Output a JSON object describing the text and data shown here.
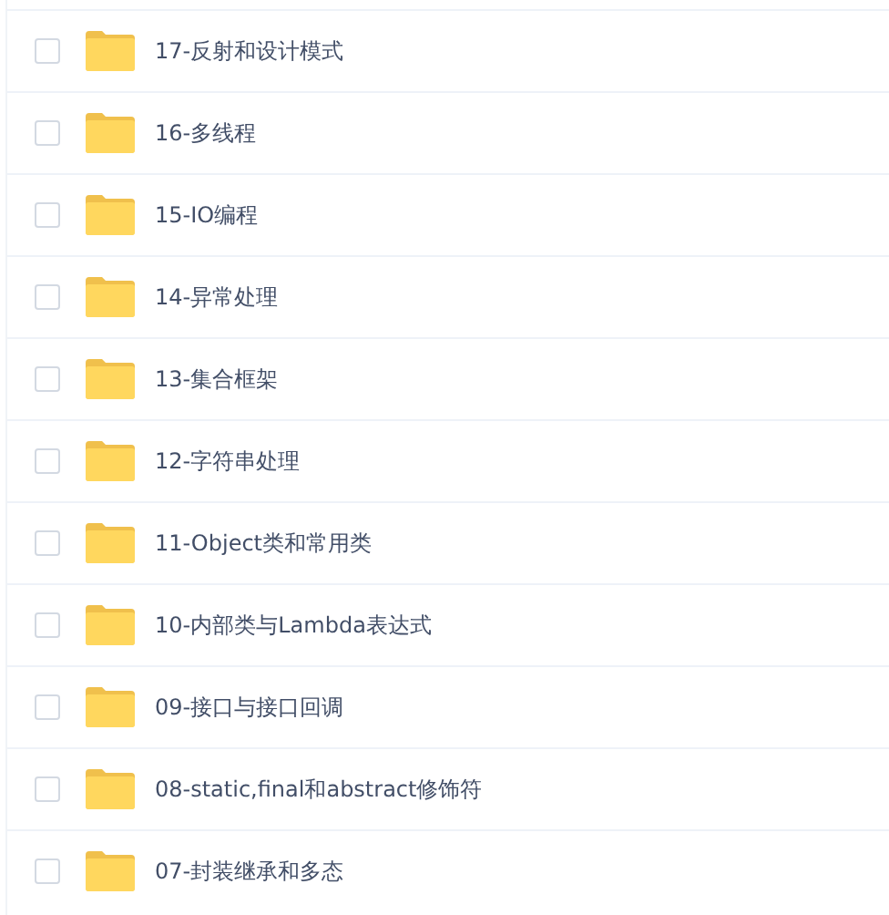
{
  "folders": [
    {
      "name": "17-反射和设计模式",
      "checked": false
    },
    {
      "name": "16-多线程",
      "checked": false
    },
    {
      "name": "15-IO编程",
      "checked": false
    },
    {
      "name": "14-异常处理",
      "checked": false
    },
    {
      "name": "13-集合框架",
      "checked": false
    },
    {
      "name": "12-字符串处理",
      "checked": false
    },
    {
      "name": "11-Object类和常用类",
      "checked": false
    },
    {
      "name": "10-内部类与Lambda表达式",
      "checked": false
    },
    {
      "name": "09-接口与接口回调",
      "checked": false
    },
    {
      "name": "08-static,final和abstract修饰符",
      "checked": false
    },
    {
      "name": "07-封装继承和多态",
      "checked": false
    }
  ]
}
